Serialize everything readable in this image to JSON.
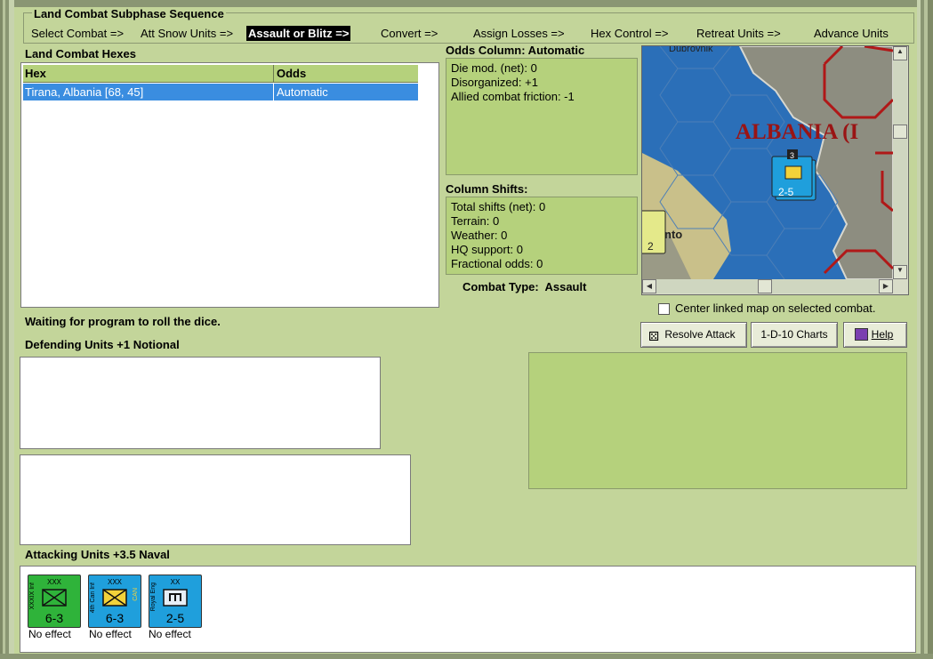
{
  "sequence": {
    "title": "Land Combat Subphase Sequence",
    "steps": [
      "Select Combat =>",
      "Att Snow Units =>",
      "Assault or Blitz =>",
      "Convert =>",
      "Assign Losses =>",
      "Hex Control =>",
      "Retreat Units =>",
      "Advance Units"
    ],
    "active_index": 2
  },
  "hexes": {
    "title": "Land Combat Hexes",
    "columns": [
      "Hex",
      "Odds"
    ],
    "rows": [
      [
        "Tirana, Albania [68, 45]",
        "Automatic"
      ]
    ]
  },
  "odds": {
    "title": "Odds Column: Automatic",
    "lines": [
      "Die mod. (net): 0",
      "Disorganized: +1",
      "Allied combat friction: -1"
    ]
  },
  "shifts": {
    "title": "Column Shifts:",
    "lines": [
      "Total shifts (net): 0",
      "Terrain: 0",
      "Weather: 0",
      "HQ support: 0",
      "Fractional odds: 0"
    ]
  },
  "combat_type": {
    "label": "Combat Type:",
    "value": "Assault"
  },
  "map": {
    "region_label": "ALBANIA (I",
    "place_label": "nto",
    "top_label": "Dubrovnik",
    "unit_value": "2-5",
    "stack_count": "3",
    "edge_unit": "2"
  },
  "center_linked": {
    "label": "Center linked map on selected combat.",
    "checked": false
  },
  "buttons": {
    "resolve": "Resolve Attack",
    "charts": "1-D-10 Charts",
    "help": "Help"
  },
  "status": "Waiting for program to roll the dice.",
  "defending": {
    "title": "Defending Units +1 Notional"
  },
  "attacking": {
    "title": "Attacking Units +3.5 Naval",
    "units": [
      {
        "strength": "6-3",
        "size": "XXX",
        "name": "XXXIX Inf",
        "result": "No effect",
        "color": "#2fb33a"
      },
      {
        "strength": "6-3",
        "size": "XXX",
        "name": "4th Can Inf",
        "tag": "CAN",
        "result": "No effect",
        "color": "#1f9fdc"
      },
      {
        "strength": "2-5",
        "size": "XX",
        "name": "Royal Eng",
        "result": "No effect",
        "color": "#1f9fdc"
      }
    ]
  },
  "colors": {
    "panel": "#c3d59a",
    "green_box": "#b5d17c",
    "selection": "#3a8de0",
    "sea": "#2b6fb8",
    "border_red": "#b01818"
  }
}
